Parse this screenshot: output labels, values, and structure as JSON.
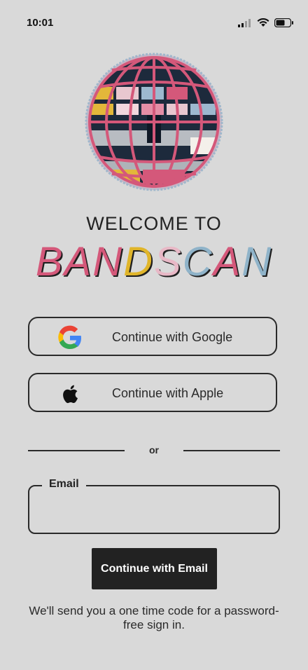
{
  "status_bar": {
    "time": "10:01",
    "icons": [
      "cellular-signal-icon",
      "wifi-icon",
      "battery-icon"
    ]
  },
  "welcome": {
    "line1": "WELCOME TO",
    "brand_letters": [
      {
        "char": "B",
        "color": "#d4587a"
      },
      {
        "char": "A",
        "color": "#d4587a"
      },
      {
        "char": "N",
        "color": "#d4587a"
      },
      {
        "char": "D",
        "color": "#e0b52a"
      },
      {
        "char": "S",
        "color": "#e8b8c6"
      },
      {
        "char": "C",
        "color": "#8fb3c9"
      },
      {
        "char": "A",
        "color": "#d4587a"
      },
      {
        "char": "N",
        "color": "#8fb3c9"
      }
    ]
  },
  "auth": {
    "google_label": "Continue with Google",
    "apple_label": "Continue with Apple",
    "or_text": "or",
    "email_label": "Email",
    "email_value": "",
    "email_button_label": "Continue with Email",
    "note": "We'll send you a one time code for a password-free sign in."
  },
  "colors": {
    "background": "#d9d9d9",
    "accent_pink": "#d4587a",
    "button_dark": "#222222"
  }
}
